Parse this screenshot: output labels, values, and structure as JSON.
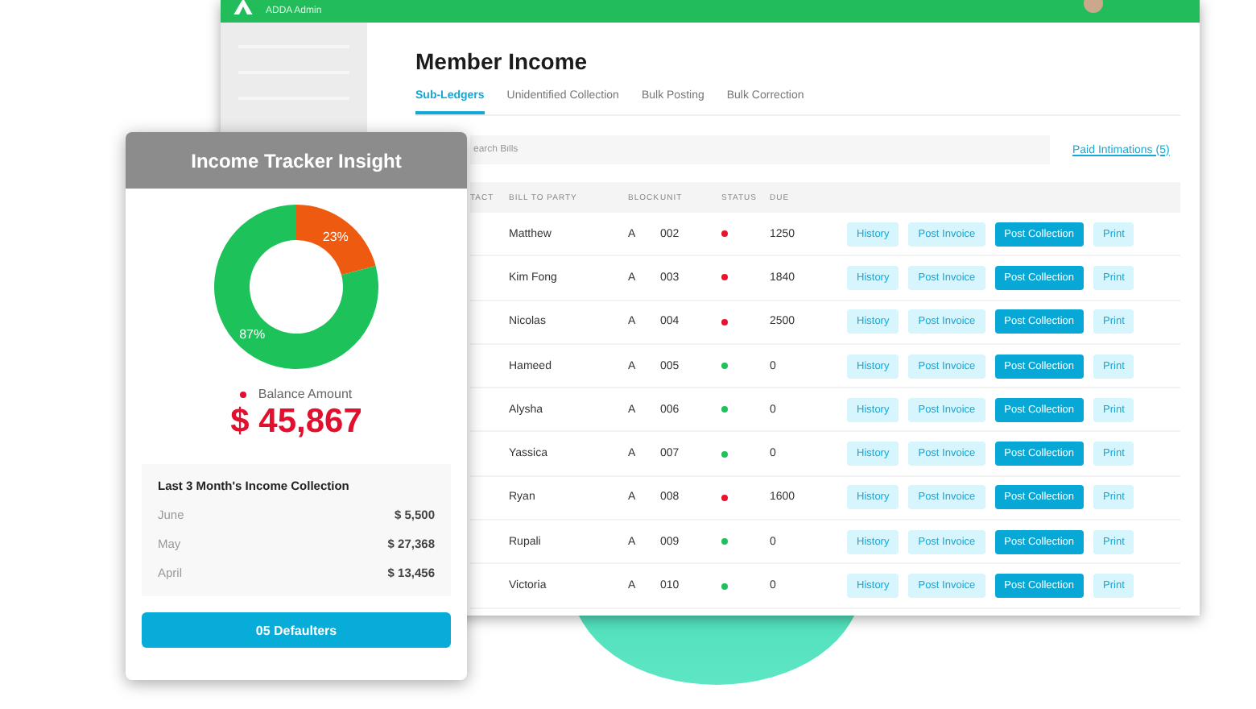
{
  "app": {
    "brand": "ADDA Admin"
  },
  "page": {
    "title": "Member Income",
    "tabs": [
      {
        "label": "Sub-Ledgers",
        "selected": true
      },
      {
        "label": "Unidentified Collection",
        "selected": false
      },
      {
        "label": "Bulk Posting",
        "selected": false
      },
      {
        "label": "Bulk Correction",
        "selected": false
      }
    ],
    "search": {
      "placeholder": "earch Bills"
    },
    "paid_link": "Paid Intimations (5)",
    "table": {
      "columns": [
        "TACT",
        "BILL TO PARTY",
        "BLOCK",
        "UNIT",
        "STATUS",
        "DUE"
      ],
      "rows": [
        {
          "name": "Matthew",
          "block": "A",
          "unit": "002",
          "color": "#e8142d",
          "due": "1250",
          "actions": [
            {
              "label": "History",
              "kind": "light"
            },
            {
              "label": "Post Invoice",
              "kind": "light"
            },
            {
              "label": "Post Collection",
              "kind": "primary"
            },
            {
              "label": "Print",
              "kind": "light"
            }
          ]
        },
        {
          "name": "Kim Fong",
          "block": "A",
          "unit": "003",
          "color": "#e8142d",
          "due": "1840",
          "actions": [
            {
              "label": "History",
              "kind": "light"
            },
            {
              "label": "Post Invoice",
              "kind": "light"
            },
            {
              "label": "Post Collection",
              "kind": "primary"
            },
            {
              "label": "Print",
              "kind": "light"
            }
          ]
        },
        {
          "name": "Nicolas",
          "block": "A",
          "unit": "004",
          "color": "#e8142d",
          "due": "2500",
          "actions": [
            {
              "label": "History",
              "kind": "light"
            },
            {
              "label": "Post Invoice",
              "kind": "light"
            },
            {
              "label": "Post Collection",
              "kind": "primary"
            },
            {
              "label": "Print",
              "kind": "light"
            }
          ]
        },
        {
          "name": "Hameed",
          "block": "A",
          "unit": "005",
          "color": "#1ec25a",
          "due": "0",
          "actions": [
            {
              "label": "History",
              "kind": "light"
            },
            {
              "label": "Post Invoice",
              "kind": "light"
            },
            {
              "label": "Post Collection",
              "kind": "primary"
            },
            {
              "label": "Print",
              "kind": "light"
            }
          ]
        },
        {
          "name": "Alysha",
          "block": "A",
          "unit": "006",
          "color": "#1ec25a",
          "due": "0",
          "actions": [
            {
              "label": "History",
              "kind": "light"
            },
            {
              "label": "Post Invoice",
              "kind": "light"
            },
            {
              "label": "Post Collection",
              "kind": "primary"
            },
            {
              "label": "Print",
              "kind": "light"
            }
          ]
        },
        {
          "name": "Yassica",
          "block": "A",
          "unit": "007",
          "color": "#1ec25a",
          "due": "0",
          "actions": [
            {
              "label": "History",
              "kind": "light"
            },
            {
              "label": "Post Invoice",
              "kind": "light"
            },
            {
              "label": "Post Collection",
              "kind": "primary"
            },
            {
              "label": "Print",
              "kind": "light"
            }
          ]
        },
        {
          "name": "Ryan",
          "block": "A",
          "unit": "008",
          "color": "#e8142d",
          "due": "1600",
          "actions": [
            {
              "label": "History",
              "kind": "light"
            },
            {
              "label": "Post Invoice",
              "kind": "light"
            },
            {
              "label": "Post Collection",
              "kind": "primary"
            },
            {
              "label": "Print",
              "kind": "light"
            }
          ]
        },
        {
          "name": "Rupali",
          "block": "A",
          "unit": "009",
          "color": "#1ec25a",
          "due": "0",
          "actions": [
            {
              "label": "History",
              "kind": "light"
            },
            {
              "label": "Post Invoice",
              "kind": "light"
            },
            {
              "label": "Post Collection",
              "kind": "primary"
            },
            {
              "label": "Print",
              "kind": "light"
            }
          ]
        },
        {
          "name": "Victoria",
          "block": "A",
          "unit": "010",
          "color": "#1ec25a",
          "due": "0",
          "actions": [
            {
              "label": "History",
              "kind": "light"
            },
            {
              "label": "Post Invoice",
              "kind": "light"
            },
            {
              "label": "Post Collection",
              "kind": "primary"
            },
            {
              "label": "Print",
              "kind": "light"
            }
          ]
        }
      ]
    }
  },
  "insight": {
    "title": "Income Tracker Insight",
    "chart_data": {
      "type": "donut",
      "values": [
        23,
        87
      ],
      "colors": [
        "#ee5a0f",
        "#1ec25a"
      ],
      "value_labels": [
        "23%",
        "87%"
      ]
    },
    "balance": {
      "label": "Balance Amount",
      "amount": "$ 45,867"
    },
    "collection": {
      "title": "Last 3 Month's Income Collection",
      "months": [
        {
          "month": "June",
          "amount": "$ 5,500"
        },
        {
          "month": "May",
          "amount": "$ 27,368"
        },
        {
          "month": "April",
          "amount": "$ 13,456"
        }
      ]
    },
    "button": "05 Defaulters"
  }
}
